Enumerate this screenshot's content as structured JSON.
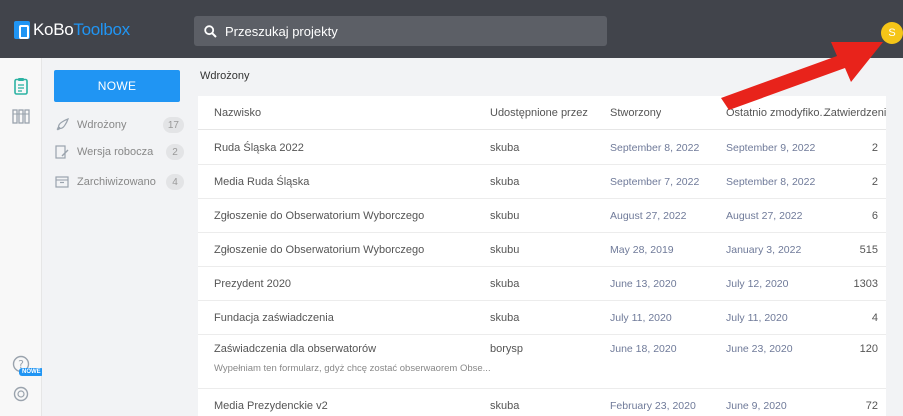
{
  "topbar": {
    "logo_part1": "KoBo",
    "logo_part2": "Toolbox",
    "search_placeholder": "Przeszukaj projekty",
    "avatar_letter": "S"
  },
  "rail": {
    "new_badge": "NOWE"
  },
  "sidebar": {
    "new_button": "NOWE",
    "items": [
      {
        "label": "Wdrożony",
        "count": "17",
        "icon": "rocket-icon"
      },
      {
        "label": "Wersja robocza",
        "count": "2",
        "icon": "draft-icon"
      },
      {
        "label": "Zarchiwizowano",
        "count": "4",
        "icon": "archive-icon"
      }
    ]
  },
  "main": {
    "section_title": "Wdrożony",
    "columns": [
      "Nazwisko",
      "Udostępnione przez",
      "Stworzony",
      "Ostatnio zmodyfiko...",
      "Zatwierdzenia"
    ],
    "rows": [
      {
        "name": "Ruda Śląska 2022",
        "owner": "skuba",
        "created": "September 8, 2022",
        "modified": "September 9, 2022",
        "submissions": "2",
        "desc": ""
      },
      {
        "name": "Media Ruda Śląska",
        "owner": "skuba",
        "created": "September 7, 2022",
        "modified": "September 8, 2022",
        "submissions": "2",
        "desc": ""
      },
      {
        "name": "Zgłoszenie do Obserwatorium Wyborczego",
        "owner": "skubu",
        "created": "August 27, 2022",
        "modified": "August 27, 2022",
        "submissions": "6",
        "desc": ""
      },
      {
        "name": "Zgłoszenie do Obserwatorium Wyborczego",
        "owner": "skubu",
        "created": "May 28, 2019",
        "modified": "January 3, 2022",
        "submissions": "515",
        "desc": ""
      },
      {
        "name": "Prezydent 2020",
        "owner": "skuba",
        "created": "June 13, 2020",
        "modified": "July 12, 2020",
        "submissions": "1303",
        "desc": ""
      },
      {
        "name": "Fundacja zaświadczenia",
        "owner": "skuba",
        "created": "July 11, 2020",
        "modified": "July 11, 2020",
        "submissions": "4",
        "desc": ""
      },
      {
        "name": "Zaświadczenia dla obserwatorów",
        "owner": "borysp",
        "created": "June 18, 2020",
        "modified": "June 23, 2020",
        "submissions": "120",
        "desc": "Wypełniam ten formularz, gdyż chcę zostać obserwaorem Obse..."
      },
      {
        "name": "Media Prezydenckie v2",
        "owner": "skuba",
        "created": "February 23, 2020",
        "modified": "June 9, 2020",
        "submissions": "72",
        "desc": ""
      }
    ]
  },
  "colors": {
    "topbar": "#41444b",
    "accent": "#2095f3",
    "arrow": "#e8231b",
    "avatar": "#f5c518"
  }
}
